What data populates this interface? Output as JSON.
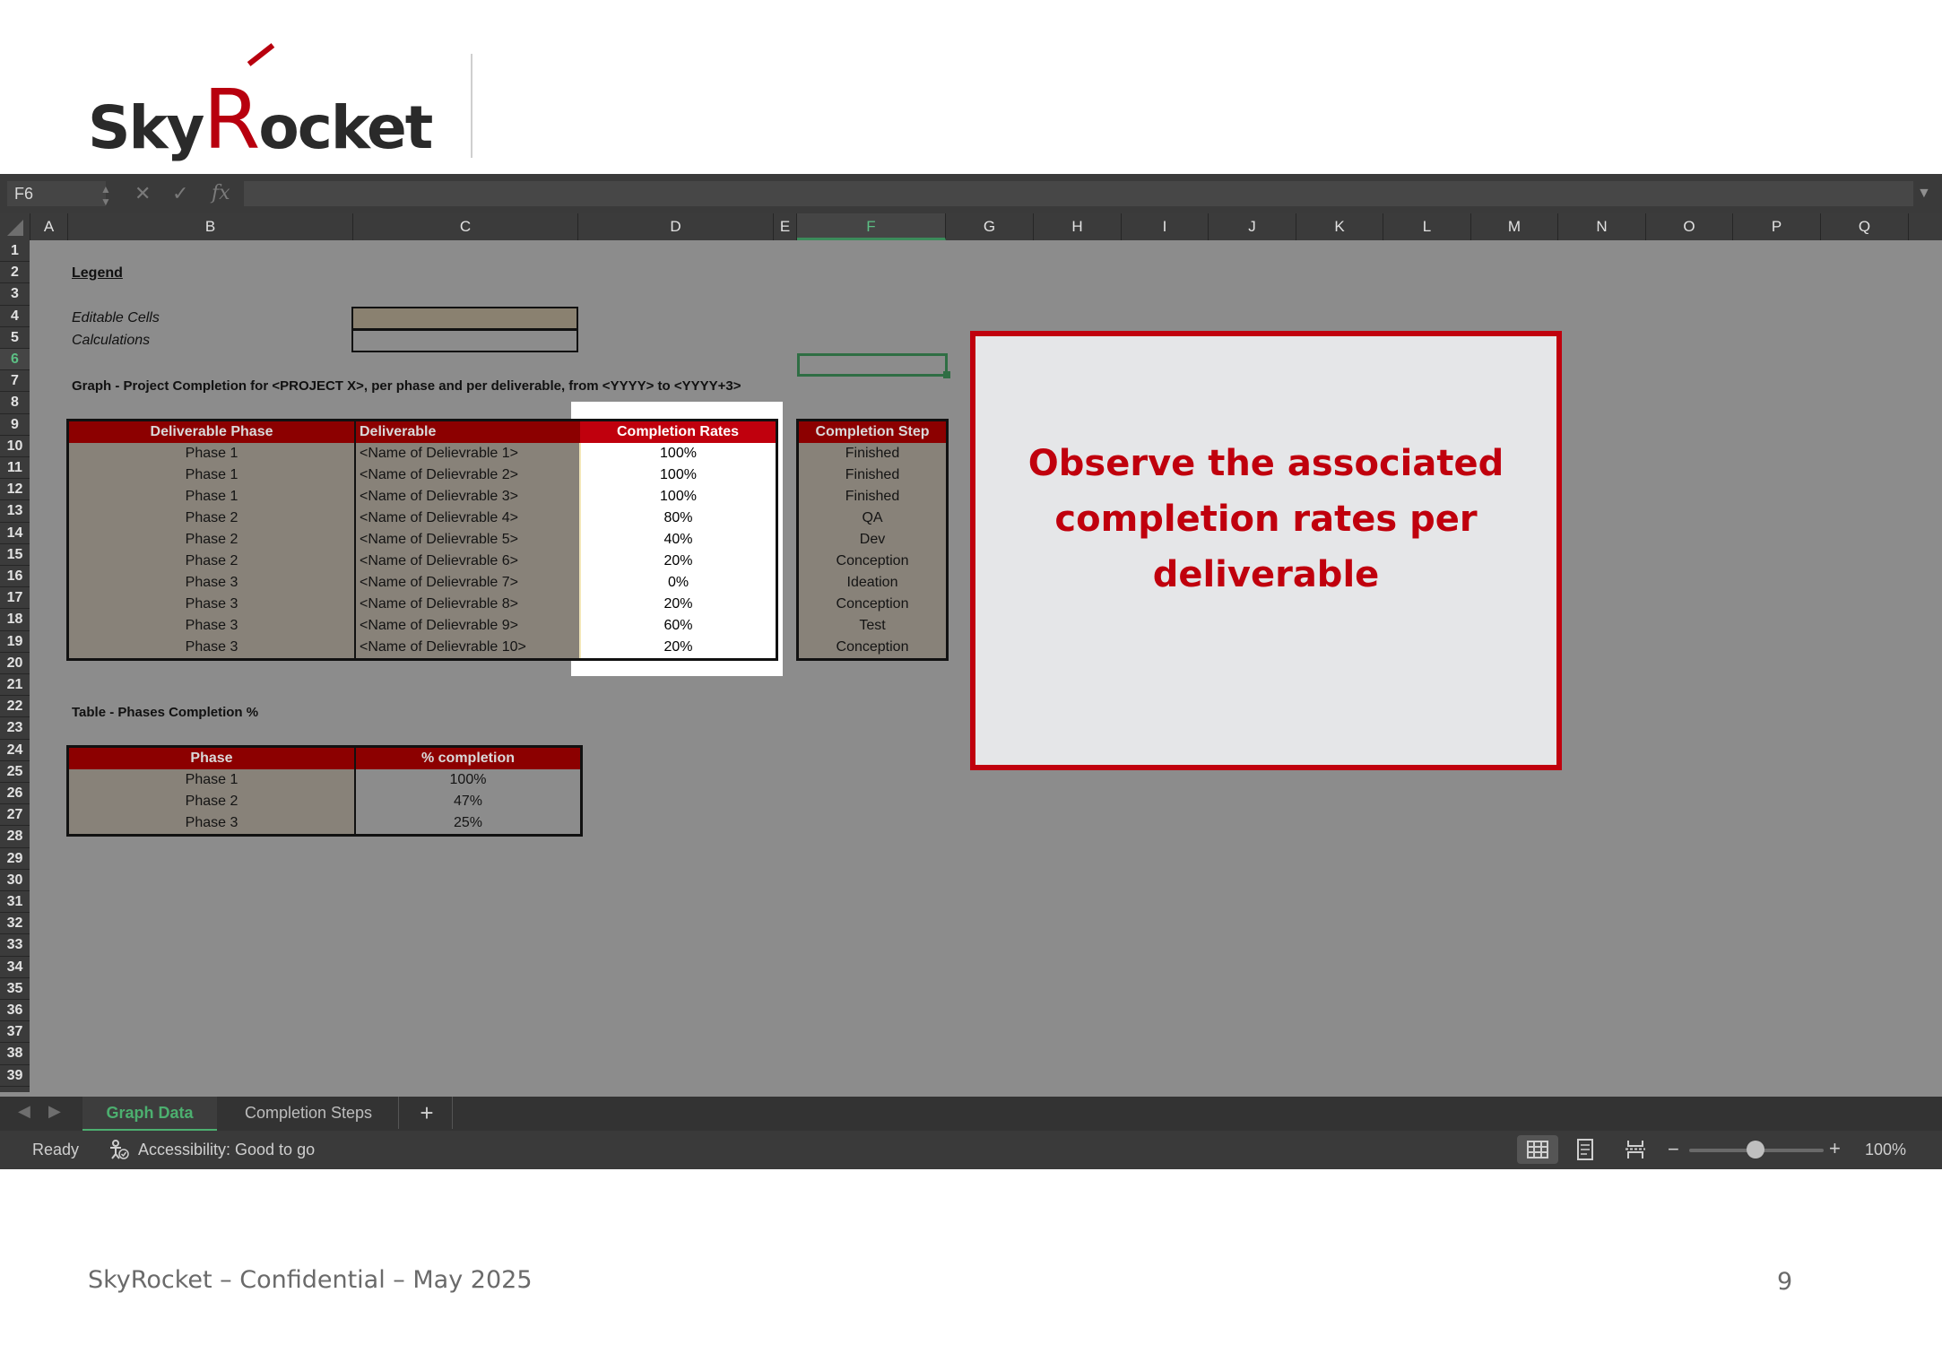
{
  "logo": {
    "text_sky": "Sky",
    "text_r": "R",
    "text_rest": "ocket"
  },
  "excel": {
    "name_box": "F6",
    "columns": [
      "A",
      "B",
      "C",
      "D",
      "E",
      "F",
      "G",
      "H",
      "I",
      "J",
      "K",
      "L",
      "M",
      "N",
      "O",
      "P",
      "Q"
    ],
    "selected_column": "F",
    "rows": [
      "1",
      "2",
      "3",
      "4",
      "5",
      "6",
      "7",
      "8",
      "9",
      "10",
      "11",
      "12",
      "13",
      "14",
      "15",
      "16",
      "17",
      "18",
      "19",
      "20",
      "21",
      "22",
      "23",
      "24",
      "25",
      "26",
      "27",
      "28",
      "29",
      "30",
      "31",
      "32",
      "33",
      "34",
      "35",
      "36",
      "37",
      "38",
      "39"
    ],
    "legend": {
      "title": "Legend",
      "editable": "Editable Cells",
      "calculations": "Calculations"
    },
    "graph_title": "Graph - Project Completion for <PROJECT X>, per phase and per deliverable, from <YYYY> to <YYYY+3>",
    "deliverables_table": {
      "headers": {
        "phase": "Deliverable Phase",
        "deliverable": "Deliverable",
        "rate": "Completion Rates",
        "step": "Completion Step"
      },
      "rows": [
        {
          "phase": "Phase 1",
          "deliverable": "<Name of Delievrable 1>",
          "rate": "100%",
          "step": "Finished"
        },
        {
          "phase": "Phase 1",
          "deliverable": "<Name of Delievrable 2>",
          "rate": "100%",
          "step": "Finished"
        },
        {
          "phase": "Phase 1",
          "deliverable": "<Name of Delievrable 3>",
          "rate": "100%",
          "step": "Finished"
        },
        {
          "phase": "Phase 2",
          "deliverable": "<Name of Delievrable 4>",
          "rate": "80%",
          "step": "QA"
        },
        {
          "phase": "Phase 2",
          "deliverable": "<Name of Delievrable 5>",
          "rate": "40%",
          "step": "Dev"
        },
        {
          "phase": "Phase 2",
          "deliverable": "<Name of Delievrable 6>",
          "rate": "20%",
          "step": "Conception"
        },
        {
          "phase": "Phase 3",
          "deliverable": "<Name of Delievrable 7>",
          "rate": "0%",
          "step": "Ideation"
        },
        {
          "phase": "Phase 3",
          "deliverable": "<Name of Delievrable 8>",
          "rate": "20%",
          "step": "Conception"
        },
        {
          "phase": "Phase 3",
          "deliverable": "<Name of Delievrable 9>",
          "rate": "60%",
          "step": "Test"
        },
        {
          "phase": "Phase 3",
          "deliverable": "<Name of Delievrable 10>",
          "rate": "20%",
          "step": "Conception"
        }
      ]
    },
    "phases_title": "Table - Phases Completion %",
    "phases_table": {
      "headers": {
        "phase": "Phase",
        "completion": "% completion"
      },
      "rows": [
        {
          "phase": "Phase 1",
          "completion": "100%"
        },
        {
          "phase": "Phase 2",
          "completion": "47%"
        },
        {
          "phase": "Phase 3",
          "completion": "25%"
        }
      ]
    },
    "callout": "Observe the associated completion rates per deliverable",
    "sheet_tabs": [
      {
        "label": "Graph Data",
        "active": true
      },
      {
        "label": "Completion Steps",
        "active": false
      }
    ],
    "status": {
      "ready": "Ready",
      "accessibility": "Accessibility: Good to go",
      "zoom": "100%"
    }
  },
  "footer": {
    "text": "SkyRocket – Confidential – May 2025",
    "page": "9"
  }
}
